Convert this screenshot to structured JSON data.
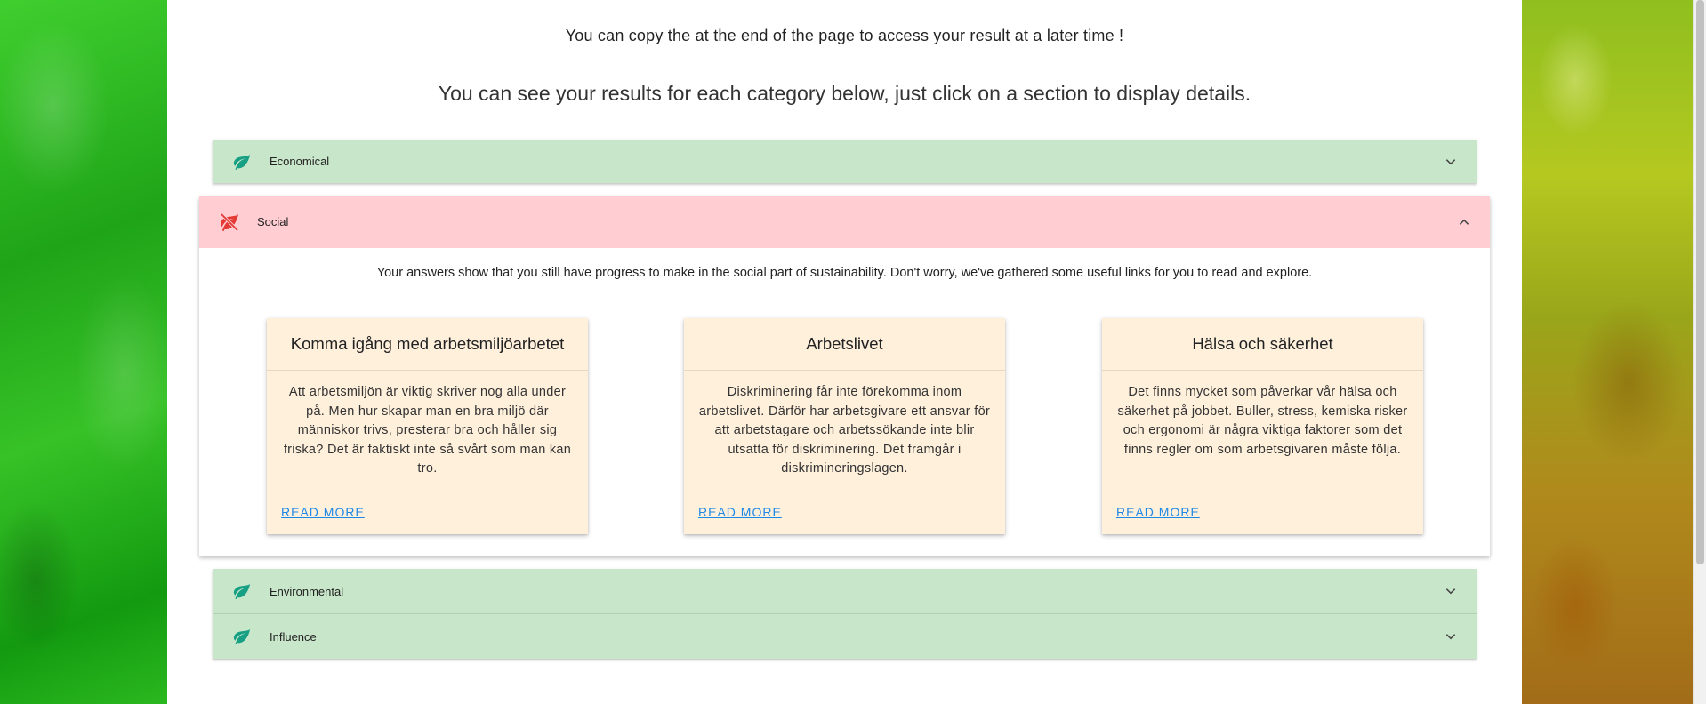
{
  "notice": "You can copy the at the end of the page to access your result at a later time !",
  "lead": "You can see your results for each category below, just click on a section to display details.",
  "colors": {
    "positive_panel": "#c8e6c9",
    "negative_panel": "#ffcdd2",
    "card_bg": "#fff0dc",
    "leaf_green": "#18a085",
    "leaf_red": "#e53935",
    "link": "#1e88e5"
  },
  "categories": [
    {
      "label": "Economical",
      "status": "good",
      "icon": "leaf-icon",
      "expanded": false
    },
    {
      "label": "Social",
      "status": "needs-progress",
      "icon": "leaf-off-icon",
      "expanded": true
    },
    {
      "label": "Environmental",
      "status": "good",
      "icon": "leaf-icon",
      "expanded": false
    },
    {
      "label": "Influence",
      "status": "good",
      "icon": "leaf-icon",
      "expanded": false
    }
  ],
  "social": {
    "message": "Your answers show that you still have progress to make in the social part of sustainability. Don't worry, we've gathered some useful links for you to read and explore.",
    "cards": [
      {
        "title": "Komma igång med arbetsmiljöarbetet",
        "body": "Att arbetsmiljön är viktig skriver nog alla under på. Men hur skapar man en bra miljö där människor trivs, presterar bra och håller sig friska? Det är faktiskt inte så svårt som man kan tro.",
        "link": "READ MORE"
      },
      {
        "title": "Arbetslivet",
        "body": "Diskriminering får inte förekomma inom arbetslivet. Därför har arbetsgivare ett ansvar för att arbetstagare och arbetssökande inte blir utsatta för diskriminering. Det framgår i diskrimineringslagen.",
        "link": "READ MORE"
      },
      {
        "title": "Hälsa och säkerhet",
        "body": "Det finns mycket som påverkar vår hälsa och säkerhet på jobbet. Buller, stress, kemiska risker och ergonomi är några viktiga faktorer som det finns regler om som arbetsgivaren måste följa.",
        "link": "READ MORE"
      }
    ]
  }
}
